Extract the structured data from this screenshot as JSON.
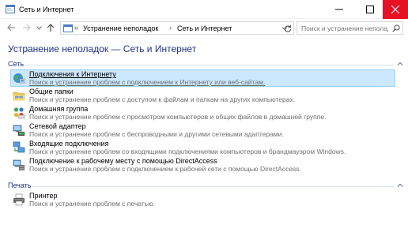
{
  "window": {
    "title": "Сеть и Интернет",
    "icons": {
      "app": "troubleshoot-window-icon",
      "minimize": "minimize-icon",
      "maximize": "maximize-icon",
      "close": "close-icon"
    },
    "close_color": "#e81123"
  },
  "navigation": {
    "back_icon": "arrow-left-icon",
    "forward_icon": "arrow-right-icon",
    "recent_icon": "chevron-down-icon",
    "up_icon": "arrow-up-icon",
    "address": {
      "root_chevron": "«",
      "crumbs": [
        "Устранение неполадок",
        "Сеть и Интернет"
      ],
      "separator": "›"
    },
    "refresh_icon": "refresh-icon",
    "search": {
      "placeholder": "Поиск и устранение неполад...",
      "icon": "search-icon"
    }
  },
  "page": {
    "title": "Устранение неполадок — Сеть и Интернет",
    "accent_color": "#1e3287"
  },
  "groups": [
    {
      "title": "Сеть",
      "items": [
        {
          "title": "Подключения к Интернету",
          "description": "Поиск и устранение проблем с подключением к Интернету или веб-сайтам.",
          "icon": "internet-globe-icon",
          "selected": true
        },
        {
          "title": "Общие папки",
          "description": "Поиск и устранение проблем с доступом к файлам и папкам на других компьютерах.",
          "icon": "shared-folder-icon",
          "selected": false
        },
        {
          "title": "Домашняя группа",
          "description": "Поиск и устранение проблем с просмотром компьютеров и общих файлов в домашней группе.",
          "icon": "homegroup-icon",
          "selected": false
        },
        {
          "title": "Сетевой адаптер",
          "description": "Поиск и устранение проблем с беспроводными и другими сетевыми адаптерами.",
          "icon": "network-adapter-icon",
          "selected": false
        },
        {
          "title": "Входящие подключения",
          "description": "Поиск и устранение проблем со входящими подключениями компьютеров и брандмауэром Windows.",
          "icon": "incoming-connections-icon",
          "selected": false
        },
        {
          "title": "Подключение к рабочему месту с помощью DirectAccess",
          "description": "Поиск и устранение проблем с подключением к рабочей сети с помощью DirectAccess.",
          "icon": "directaccess-icon",
          "selected": false
        }
      ]
    },
    {
      "title": "Печать",
      "items": [
        {
          "title": "Принтер",
          "description": "Поиск и устранение проблем с печатью.",
          "icon": "printer-icon",
          "selected": false
        }
      ]
    }
  ],
  "selection_colors": {
    "background": "#cce8ff",
    "border": "#99d1ff"
  }
}
